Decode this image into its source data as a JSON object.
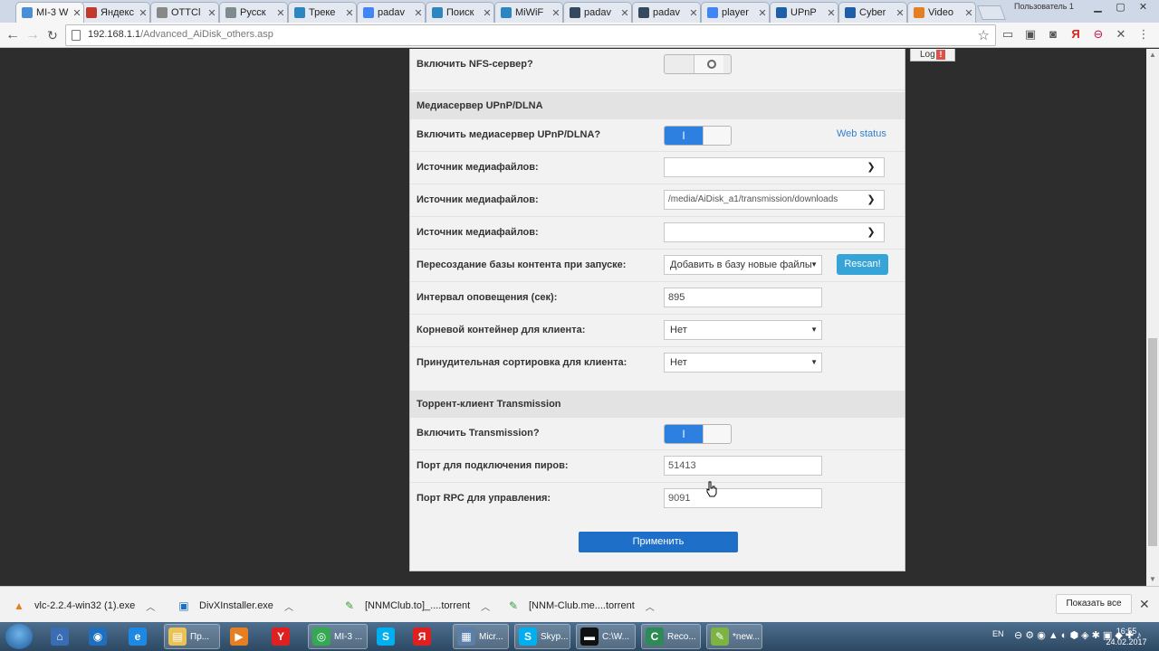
{
  "browser": {
    "tabs": [
      {
        "title": "MI-3 W",
        "favicon": "wifi-icon",
        "color": "#4a8fd6",
        "active": true
      },
      {
        "title": "Яндекс",
        "favicon": "yandex-mail-icon",
        "color": "#c0392b"
      },
      {
        "title": "OTTCl",
        "favicon": "page-icon",
        "color": "#888888"
      },
      {
        "title": "Русск",
        "favicon": "tracker-icon",
        "color": "#7f8c8d"
      },
      {
        "title": "Треке",
        "favicon": "tracker-arrow-icon",
        "color": "#2e86c1"
      },
      {
        "title": "padav",
        "favicon": "google-icon",
        "color": "#4285f4"
      },
      {
        "title": "Поиск",
        "favicon": "search-icon",
        "color": "#2e86c1"
      },
      {
        "title": "MiWiF",
        "favicon": "miwifi-icon",
        "color": "#2e86c1"
      },
      {
        "title": "padav",
        "favicon": "shield-icon",
        "color": "#34495e"
      },
      {
        "title": "padav",
        "favicon": "shield-icon",
        "color": "#34495e"
      },
      {
        "title": "player",
        "favicon": "google-icon",
        "color": "#4285f4"
      },
      {
        "title": "UPnP",
        "favicon": "ru-icon",
        "color": "#1f5fa8"
      },
      {
        "title": "Cyber",
        "favicon": "ru-icon",
        "color": "#1f5fa8"
      },
      {
        "title": "Video",
        "favicon": "vlc-icon",
        "color": "#e67e22"
      }
    ],
    "profile_label": "Пользователь 1",
    "url_host": "192.168.1.1",
    "url_path": "/Advanced_AiDisk_others.asp"
  },
  "page": {
    "log_label": "Log",
    "log_badge": "!",
    "nfs": {
      "label": "Включить NFS-сервер?",
      "state": "off"
    },
    "dlna_section": {
      "title": "Медиасервер UPnP/DLNA"
    },
    "dlna_enable": {
      "label": "Включить медиасервер UPnP/DLNA?",
      "toggle_on_glyph": "I",
      "state": "on",
      "link": "Web status"
    },
    "media_source_1": {
      "label": "Источник медиафайлов:",
      "value": ""
    },
    "media_source_2": {
      "label": "Источник медиафайлов:",
      "value": "/media/AiDisk_a1/transmission/downloads"
    },
    "media_source_3": {
      "label": "Источник медиафайлов:",
      "value": ""
    },
    "rebuild_db": {
      "label": "Пересоздание базы контента при запуске:",
      "value": "Добавить в базу новые файлы",
      "button": "Rescan!"
    },
    "notify_interval": {
      "label": "Интервал оповещения (сек):",
      "value": "895"
    },
    "root_container": {
      "label": "Корневой контейнер для клиента:",
      "value": "Нет"
    },
    "forced_sort": {
      "label": "Принудительная сортировка для клиента:",
      "value": "Нет"
    },
    "torrent_section": {
      "title": "Торрент-клиент Transmission"
    },
    "transmission_enable": {
      "label": "Включить Transmission?",
      "toggle_on_glyph": "I",
      "state": "on"
    },
    "peer_port": {
      "label": "Порт для подключения пиров:",
      "value": "51413"
    },
    "rpc_port": {
      "label": "Порт RPC для управления:",
      "value": "9091"
    },
    "apply_button": "Применить"
  },
  "downloads": {
    "items": [
      {
        "name": "vlc-2.2.4-win32 (1).exe",
        "icon": "vlc-icon"
      },
      {
        "name": "DivXInstaller.exe",
        "icon": "installer-icon"
      },
      {
        "name": "[NNMClub.to]_....torrent",
        "icon": "torrent-icon"
      },
      {
        "name": "[NNM-Club.me....torrent",
        "icon": "torrent-icon"
      }
    ],
    "show_all": "Показать все"
  },
  "taskbar": {
    "items": [
      {
        "label": "",
        "icon": "network-icon",
        "color": "#3b6db5"
      },
      {
        "label": "",
        "icon": "ie-icon",
        "color": "#1f6fbf"
      },
      {
        "label": "",
        "icon": "ie-e-icon",
        "color": "#1e88e5"
      },
      {
        "label": "Пр...",
        "icon": "folder-icon",
        "color": "#e8c35a"
      },
      {
        "label": "",
        "icon": "media-player-icon",
        "color": "#e67e22"
      },
      {
        "label": "",
        "icon": "yandex-icon",
        "color": "#e02020"
      },
      {
        "label": "MI-3 ...",
        "icon": "chrome-icon",
        "color": "#34a853"
      },
      {
        "label": "",
        "icon": "skype-icon",
        "color": "#00aff0"
      },
      {
        "label": "",
        "icon": "yandex-browser-icon",
        "color": "#e02020"
      },
      {
        "label": "Micr...",
        "icon": "app-icon",
        "color": "#5b7fa8"
      },
      {
        "label": "Skyp...",
        "icon": "skype-icon",
        "color": "#00aff0"
      },
      {
        "label": "C:\\W...",
        "icon": "console-icon",
        "color": "#111111"
      },
      {
        "label": "Reco...",
        "icon": "camtasia-icon",
        "color": "#2e8b57"
      },
      {
        "label": "*new...",
        "icon": "notepad-icon",
        "color": "#7cb342"
      }
    ],
    "lang": "EN",
    "time": "16:55",
    "date": "24.02.2017"
  }
}
